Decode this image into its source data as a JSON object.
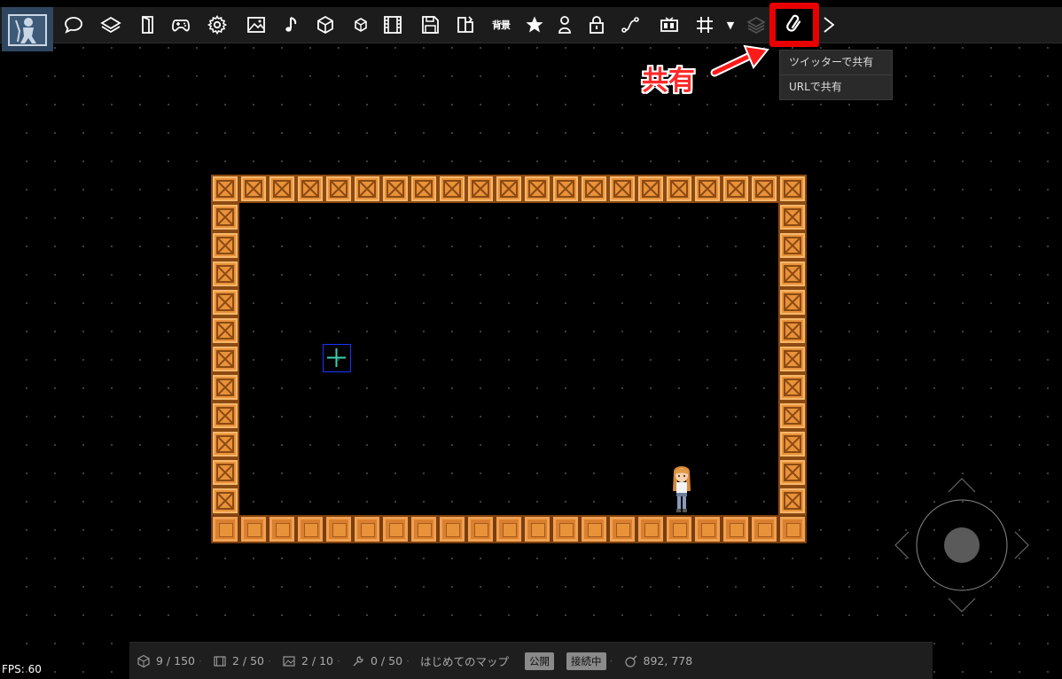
{
  "toolbar": {
    "buttons": [
      {
        "name": "speech-bubble-icon"
      },
      {
        "name": "layers-icon"
      },
      {
        "name": "door-icon"
      },
      {
        "name": "gamepad-icon"
      },
      {
        "name": "gear-icon"
      },
      {
        "name": "image-icon"
      },
      {
        "name": "music-note-icon"
      },
      {
        "name": "cube-icon"
      },
      {
        "name": "small-cube-icon"
      },
      {
        "name": "film-icon"
      },
      {
        "name": "save-icon"
      },
      {
        "name": "export-icon"
      },
      {
        "name": "background-text",
        "label": "背景"
      },
      {
        "name": "star-icon"
      },
      {
        "name": "person-icon"
      },
      {
        "name": "lock-icon"
      },
      {
        "name": "path-icon"
      },
      {
        "name": "counter-icon"
      },
      {
        "name": "grid-icon"
      },
      {
        "name": "dropdown-arrow-icon",
        "label": "▼"
      },
      {
        "name": "layer-stack-icon"
      },
      {
        "name": "link-icon"
      },
      {
        "name": "next-chevron-icon"
      }
    ]
  },
  "callout": {
    "label": "共有"
  },
  "share_menu": {
    "items": [
      "ツイッターで共有",
      "URLで共有"
    ]
  },
  "status": {
    "objects": "9 / 150",
    "scenes": "2 / 50",
    "images": "2 / 10",
    "scripts": "0 / 50",
    "map_name": "はじめてのマップ",
    "public_badge": "公開",
    "connect_badge": "接続中",
    "coords": "892, 778"
  },
  "fps": "FPS: 60",
  "colors": {
    "crate": "#e8923a",
    "highlight": "#e80000",
    "cursor": "#1a34ff"
  }
}
